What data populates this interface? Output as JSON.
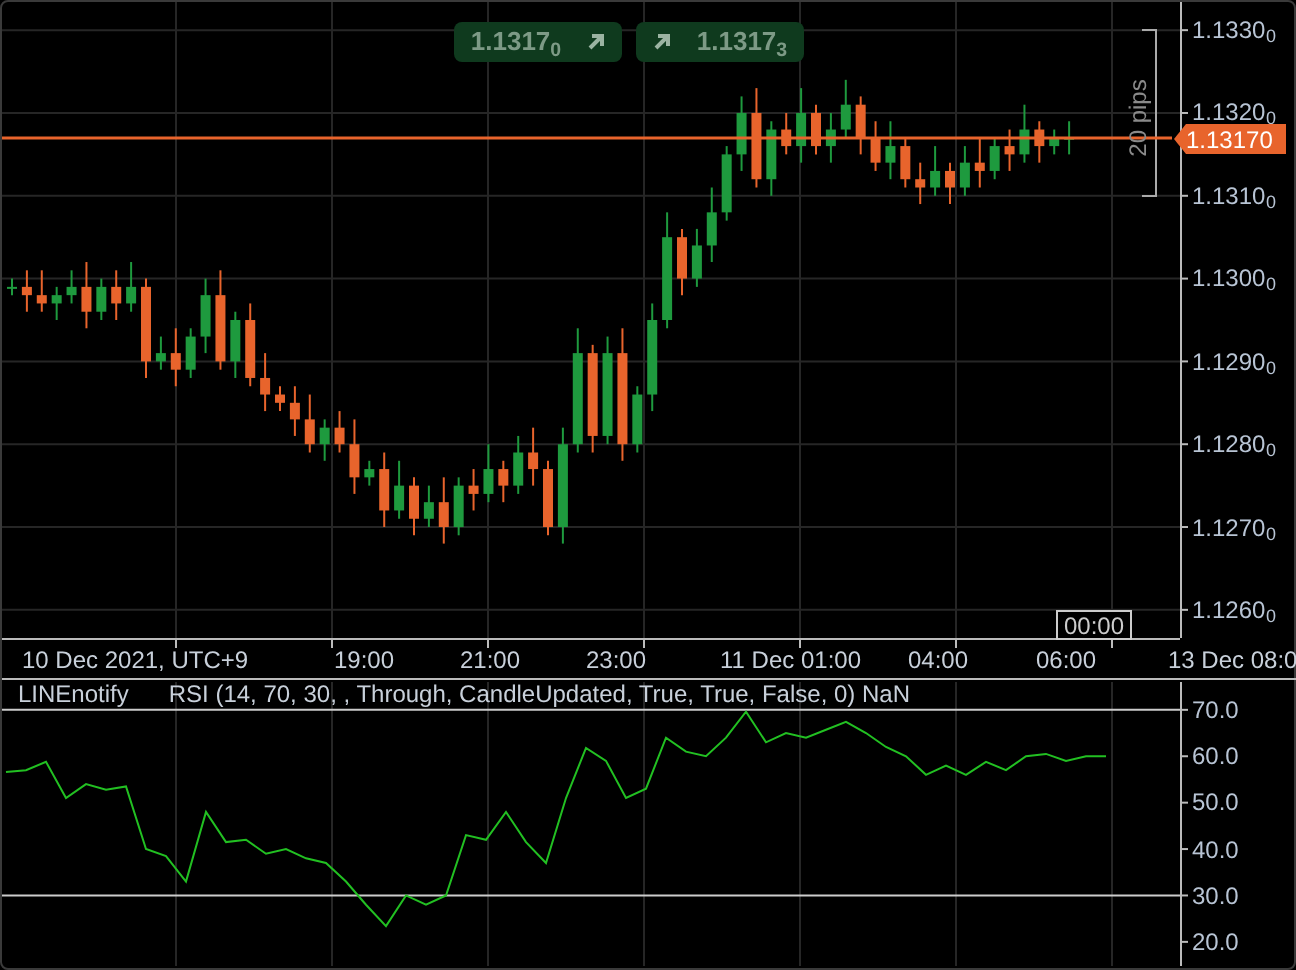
{
  "quote_buttons": [
    {
      "text": "1.1317$_{0}$"
    },
    {
      "text": "1.1317$_{3}$"
    }
  ],
  "price_chart": {
    "chart_data": {
      "type": "candlestick",
      "ylim": [
        1.12566,
        1.13334
      ],
      "grid": true,
      "yticks": [
        {
          "value": 1.133,
          "label": "1.1330"
        },
        {
          "value": 1.132,
          "label": "1.1320"
        },
        {
          "value": 1.131,
          "label": "1.1310"
        },
        {
          "value": 1.13,
          "label": "1.1300"
        },
        {
          "value": 1.129,
          "label": "1.1290"
        },
        {
          "value": 1.128,
          "label": "1.1280"
        },
        {
          "value": 1.127,
          "label": "1.1270"
        },
        {
          "value": 1.126,
          "label": "1.1260"
        }
      ],
      "ohlc": [
        [
          1.1299,
          1.13,
          1.1298,
          1.1299
        ],
        [
          1.1299,
          1.1301,
          1.1296,
          1.1298
        ],
        [
          1.1298,
          1.1301,
          1.1296,
          1.1297
        ],
        [
          1.1297,
          1.1299,
          1.1295,
          1.1298
        ],
        [
          1.1298,
          1.1301,
          1.1297,
          1.1299
        ],
        [
          1.1299,
          1.1302,
          1.1294,
          1.1296
        ],
        [
          1.1296,
          1.13,
          1.1295,
          1.1299
        ],
        [
          1.1299,
          1.1301,
          1.1295,
          1.1297
        ],
        [
          1.1297,
          1.1302,
          1.1296,
          1.1299
        ],
        [
          1.1299,
          1.13,
          1.1288,
          1.129
        ],
        [
          1.129,
          1.1293,
          1.1289,
          1.1291
        ],
        [
          1.1291,
          1.1294,
          1.1287,
          1.1289
        ],
        [
          1.1289,
          1.1294,
          1.1288,
          1.1293
        ],
        [
          1.1293,
          1.13,
          1.1291,
          1.1298
        ],
        [
          1.1298,
          1.1301,
          1.1289,
          1.129
        ],
        [
          1.129,
          1.1296,
          1.1288,
          1.1295
        ],
        [
          1.1295,
          1.1297,
          1.1287,
          1.1288
        ],
        [
          1.1288,
          1.1291,
          1.1284,
          1.1286
        ],
        [
          1.1286,
          1.1287,
          1.1284,
          1.1285
        ],
        [
          1.1285,
          1.1287,
          1.1281,
          1.1283
        ],
        [
          1.1283,
          1.1286,
          1.1279,
          1.128
        ],
        [
          1.128,
          1.1283,
          1.1278,
          1.1282
        ],
        [
          1.1282,
          1.1284,
          1.1279,
          1.128
        ],
        [
          1.128,
          1.1283,
          1.1274,
          1.1276
        ],
        [
          1.1276,
          1.1278,
          1.1275,
          1.1277
        ],
        [
          1.1277,
          1.1279,
          1.127,
          1.1272
        ],
        [
          1.1272,
          1.1278,
          1.1271,
          1.1275
        ],
        [
          1.1275,
          1.1276,
          1.1269,
          1.1271
        ],
        [
          1.1271,
          1.1275,
          1.127,
          1.1273
        ],
        [
          1.1273,
          1.1276,
          1.1268,
          1.127
        ],
        [
          1.127,
          1.1276,
          1.1269,
          1.1275
        ],
        [
          1.1275,
          1.1277,
          1.1272,
          1.1274
        ],
        [
          1.1274,
          1.128,
          1.1273,
          1.1277
        ],
        [
          1.1277,
          1.1278,
          1.1273,
          1.1275
        ],
        [
          1.1275,
          1.1281,
          1.1274,
          1.1279
        ],
        [
          1.1279,
          1.1282,
          1.1275,
          1.1277
        ],
        [
          1.1277,
          1.1278,
          1.1269,
          1.127
        ],
        [
          1.127,
          1.1282,
          1.1268,
          1.128
        ],
        [
          1.128,
          1.1294,
          1.1279,
          1.1291
        ],
        [
          1.1291,
          1.1292,
          1.1279,
          1.1281
        ],
        [
          1.1281,
          1.1293,
          1.128,
          1.1291
        ],
        [
          1.1291,
          1.1294,
          1.1278,
          1.128
        ],
        [
          1.128,
          1.1287,
          1.1279,
          1.1286
        ],
        [
          1.1286,
          1.1297,
          1.1284,
          1.1295
        ],
        [
          1.1295,
          1.1308,
          1.1294,
          1.1305
        ],
        [
          1.1305,
          1.1306,
          1.1298,
          1.13
        ],
        [
          1.13,
          1.1306,
          1.1299,
          1.1304
        ],
        [
          1.1304,
          1.1311,
          1.1302,
          1.1308
        ],
        [
          1.1308,
          1.1316,
          1.1307,
          1.1315
        ],
        [
          1.1315,
          1.1322,
          1.1313,
          1.132
        ],
        [
          1.132,
          1.1323,
          1.1311,
          1.1312
        ],
        [
          1.1312,
          1.1319,
          1.131,
          1.1318
        ],
        [
          1.1318,
          1.132,
          1.1315,
          1.1316
        ],
        [
          1.1316,
          1.1323,
          1.1314,
          1.132
        ],
        [
          1.132,
          1.1321,
          1.1315,
          1.1316
        ],
        [
          1.1316,
          1.132,
          1.1314,
          1.1318
        ],
        [
          1.1318,
          1.1324,
          1.1317,
          1.1321
        ],
        [
          1.1321,
          1.1322,
          1.1315,
          1.1317
        ],
        [
          1.1317,
          1.1319,
          1.1313,
          1.1314
        ],
        [
          1.1314,
          1.1319,
          1.1312,
          1.1316
        ],
        [
          1.1316,
          1.1317,
          1.1311,
          1.1312
        ],
        [
          1.1312,
          1.1314,
          1.1309,
          1.1311
        ],
        [
          1.1311,
          1.1316,
          1.131,
          1.1313
        ],
        [
          1.1313,
          1.1314,
          1.1309,
          1.1311
        ],
        [
          1.1311,
          1.1316,
          1.131,
          1.1314
        ],
        [
          1.1314,
          1.1317,
          1.1311,
          1.1313
        ],
        [
          1.1313,
          1.1317,
          1.1312,
          1.1316
        ],
        [
          1.1316,
          1.1318,
          1.1313,
          1.1315
        ],
        [
          1.1315,
          1.1321,
          1.1314,
          1.1318
        ],
        [
          1.1318,
          1.1319,
          1.1314,
          1.1316
        ],
        [
          1.1316,
          1.1318,
          1.1315,
          1.1317
        ],
        [
          1.1317,
          1.1319,
          1.1315,
          1.1317
        ]
      ]
    }
  },
  "price_axis": {
    "fractional_digits": [
      "0",
      "0",
      "0",
      "0",
      "0",
      "0",
      "0",
      "0"
    ]
  },
  "range_marker": {
    "label": "20 pips"
  },
  "current_price": {
    "label": "1.13170"
  },
  "time_cursor": {
    "label": "00:00"
  },
  "time_axis": {
    "labels": [
      "10 Dec 2021, UTC+9",
      "19:00",
      "21:00",
      "23:00",
      "11 Dec 01:00",
      "04:00",
      "06:00",
      "13 Dec 08:0"
    ]
  },
  "indicator": {
    "name": "LINEnotify",
    "params": "(14, 70, 30, , Through, CandleUpdated, True, True, False, 0) NaN",
    "chart_data": {
      "type": "line",
      "grid": true,
      "ylim": [
        14.8,
        76
      ],
      "yticks": [
        {
          "value": 70,
          "label": "70.0"
        },
        {
          "value": 60,
          "label": "60.0"
        },
        {
          "value": 50,
          "label": "50.0"
        },
        {
          "value": 40,
          "label": "40.0"
        },
        {
          "value": 30,
          "label": "30.0"
        },
        {
          "value": 20,
          "label": "20.0"
        }
      ],
      "series": [
        {
          "name": "RSI",
          "color": "#22c022",
          "values": [
            56.6,
            57,
            58.8,
            51,
            54,
            52.8,
            53.5,
            40,
            38.5,
            33,
            48,
            41.5,
            42,
            39,
            40,
            38,
            37,
            33,
            28,
            23.4,
            30,
            28,
            30,
            43,
            42,
            48,
            41.5,
            37,
            51,
            61.8,
            59,
            51,
            53,
            64,
            61,
            60,
            64,
            69.6,
            63,
            65,
            64,
            65.7,
            67.4,
            65,
            62,
            60,
            56,
            58,
            56,
            58.8,
            57,
            60,
            60.5,
            59,
            60,
            60
          ]
        }
      ]
    }
  }
}
